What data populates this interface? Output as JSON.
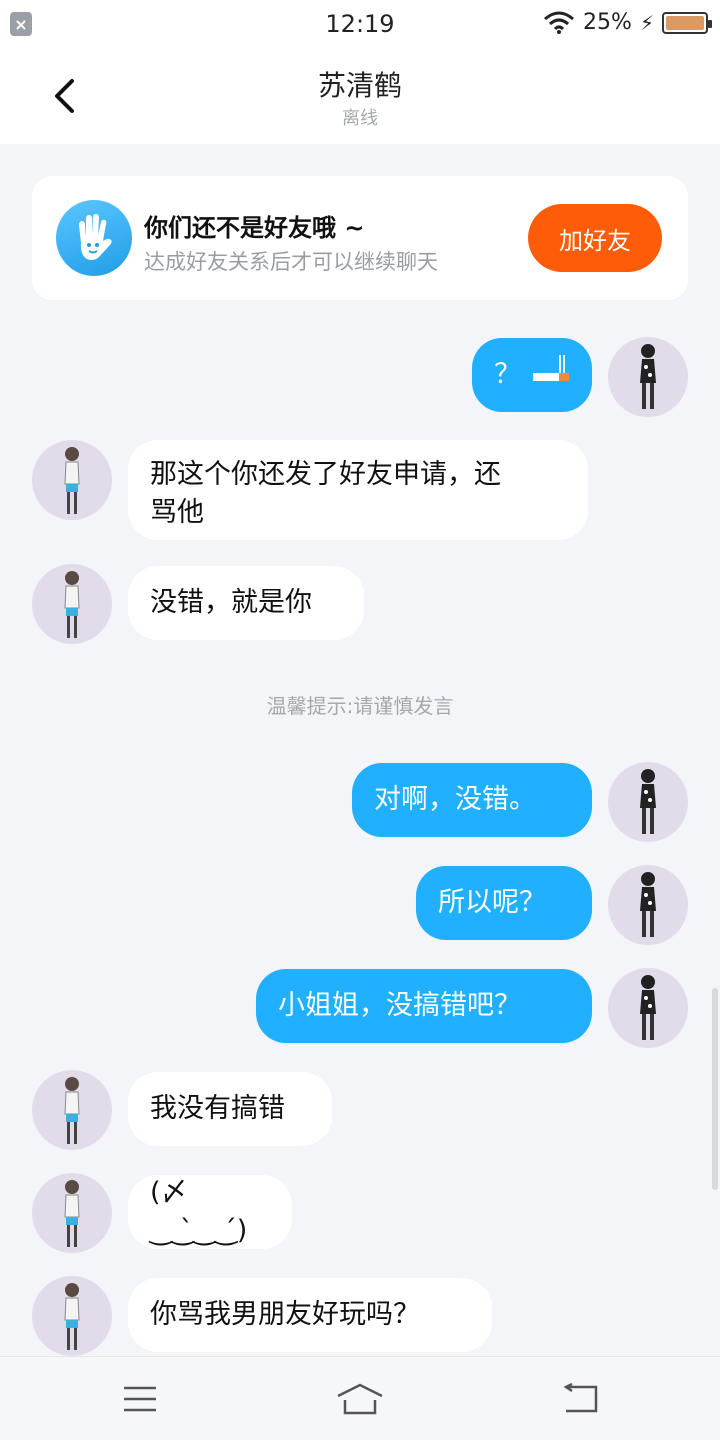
{
  "status_bar": {
    "time": "12:19",
    "battery_percent": "25%",
    "battery_level": 0.25
  },
  "header": {
    "title": "苏清鹤",
    "status": "离线"
  },
  "friend_card": {
    "title": "你们还不是好友哦 ~",
    "subtitle": "达成好友关系后才可以继续聊天",
    "button": "加好友"
  },
  "messages": [
    {
      "side": "out",
      "text": "？",
      "emoji": "cigarette"
    },
    {
      "side": "in",
      "lines": [
        "那这个你还发了好友申请，还",
        "骂他"
      ]
    },
    {
      "side": "in",
      "text": "没错，就是你"
    },
    {
      "side": "out",
      "text": "对啊，没错。"
    },
    {
      "side": "out",
      "text": "所以呢？"
    },
    {
      "side": "out",
      "text": "小姐姐，没搞错吧？"
    },
    {
      "side": "in",
      "text": "我没有搞错"
    },
    {
      "side": "in",
      "text": "(〆‿‿̀‿‿́)"
    },
    {
      "side": "in",
      "text": "你骂我男朋友好玩吗？"
    }
  ],
  "tip": "温馨提示:请谨慎发言"
}
